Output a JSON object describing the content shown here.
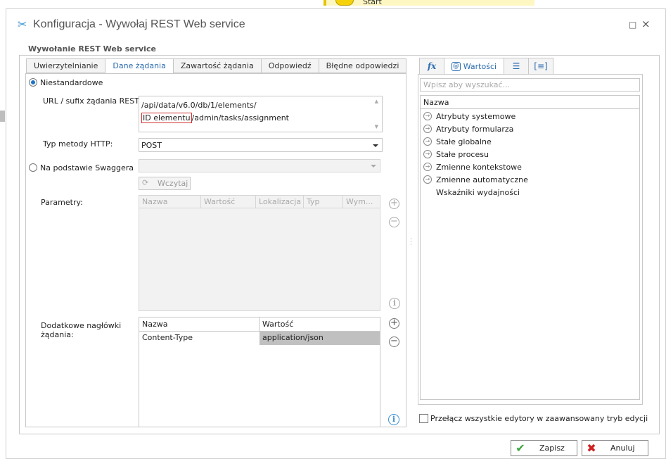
{
  "background": {
    "start_label": "Start"
  },
  "window": {
    "title": "Konfiguracja - Wywołaj REST Web service",
    "maximize_glyph": "□",
    "close_glyph": "×"
  },
  "group": {
    "title": "Wywołanie REST Web service"
  },
  "left_tabs": [
    {
      "label": "Uwierzytelnianie",
      "active": false
    },
    {
      "label": "Dane żądania",
      "active": true
    },
    {
      "label": "Zawartość żądania",
      "active": false
    },
    {
      "label": "Odpowiedź",
      "active": false
    },
    {
      "label": "Błędne odpowiedzi",
      "active": false
    }
  ],
  "request": {
    "radio_custom": "Niestandardowe",
    "url_label": "URL / sufix żądania REST:",
    "url_line1": "/api/data/v6.0/db/1/elements/",
    "url_chip": "ID elementu",
    "url_line2_rest": "/admin/tasks/assignment",
    "method_label": "Typ metody HTTP:",
    "method_value": "POST",
    "radio_swagger": "Na podstawie Swaggera",
    "load_button": "Wczytaj",
    "params_label": "Parametry:",
    "params_columns": [
      "Nazwa",
      "Wartość",
      "Lokalizacja",
      "Typ",
      "Wym..."
    ],
    "headers_label_1": "Dodatkowe nagłówki",
    "headers_label_2": "żądania:",
    "headers_columns": [
      "Nazwa",
      "Wartość"
    ],
    "headers_rows": [
      {
        "name": "Content-Type",
        "value": "application/json"
      }
    ]
  },
  "right_tabs": [
    {
      "icon": "fx-icon",
      "label": "fx"
    },
    {
      "icon": "value-icon",
      "label": "Wartości",
      "active": true
    },
    {
      "icon": "list-icon",
      "label": ""
    },
    {
      "icon": "bracket-icon",
      "label": ""
    }
  ],
  "right": {
    "search_placeholder": "Wpisz aby wyszukać...",
    "tree_header": "Nazwa",
    "tree_items": [
      {
        "label": "Atrybuty systemowe",
        "expandable": true
      },
      {
        "label": "Atrybuty formularza",
        "expandable": true
      },
      {
        "label": "Stałe globalne",
        "expandable": true
      },
      {
        "label": "Stałe procesu",
        "expandable": true
      },
      {
        "label": "Zmienne kontekstowe",
        "expandable": true
      },
      {
        "label": "Zmienne automatyczne",
        "expandable": true
      },
      {
        "label": "Wskaźniki wydajności",
        "expandable": false
      }
    ],
    "advanced_toggle": "Przełącz wszystkie edytory w zaawansowany tryb edycji"
  },
  "footer": {
    "save": "Zapisz",
    "cancel": "Anuluj"
  },
  "colors": {
    "accent": "#2b6cb0",
    "selection": "#c0c0c0",
    "save_icon": "#3aa53a",
    "cancel_icon": "#d02020"
  }
}
